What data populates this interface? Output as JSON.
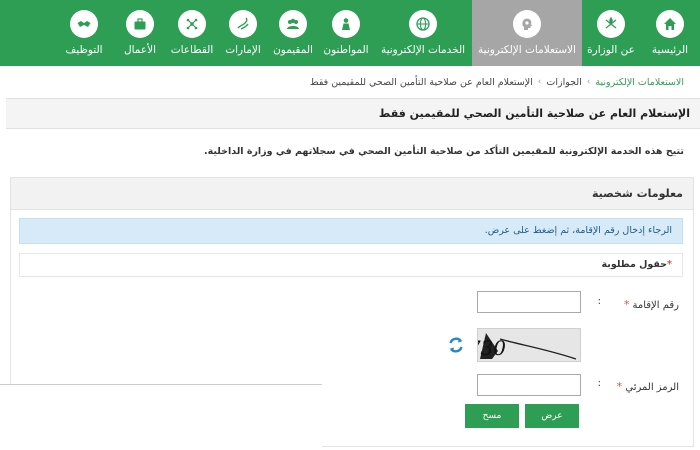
{
  "nav": {
    "items": [
      {
        "label": "الرئيسية",
        "icon": "home-icon"
      },
      {
        "label": "عن الوزارة",
        "icon": "emblem-icon"
      },
      {
        "label": "الاستعلامات الإلكترونية",
        "icon": "head-gears-icon",
        "active": true
      },
      {
        "label": "الخدمات الإلكترونية",
        "icon": "globe-icon"
      },
      {
        "label": "المواطنون",
        "icon": "person-icon"
      },
      {
        "label": "المقيمون",
        "icon": "group-icon"
      },
      {
        "label": "الإمارات",
        "icon": "calligraphy-icon"
      },
      {
        "label": "القطاعات",
        "icon": "network-icon"
      },
      {
        "label": "الأعمال",
        "icon": "briefcase-icon"
      },
      {
        "label": "التوظيف",
        "icon": "handshake-icon"
      }
    ]
  },
  "breadcrumb": {
    "link1": "الاستعلامات الإلكترونية",
    "link2": "الجوازات",
    "current": "الإستعلام العام عن صلاحية التأمين الصحي للمقيمين فقط",
    "sep": "›"
  },
  "page": {
    "title": "الإستعلام العام عن صلاحية التأمين الصحي للمقيمين فقط",
    "intro": "تتيح هذه الخدمة الإلكترونية للمقيمين التأكد من صلاحية التأمين الصحي في سجلاتهم في وزارة الداخلية."
  },
  "panel": {
    "heading": "معلومات شخصية",
    "info": "الرجاء إدخال رقم الإقامة، ثم إضغط على عرض.",
    "required_note": "حقول مطلوبة",
    "required_star": "*"
  },
  "form": {
    "iqama_label": "رقم الإقامة",
    "iqama_value": "",
    "captcha_label": "الرمز المرئي",
    "captcha_value": "",
    "captcha_text": "5730",
    "colon": ":",
    "star": "*"
  },
  "buttons": {
    "view": "عرض",
    "clear": "مسح"
  },
  "colors": {
    "brand_green": "#2e9e55",
    "active_gray": "#a6a6a6",
    "info_blue": "#d6eaf8"
  }
}
